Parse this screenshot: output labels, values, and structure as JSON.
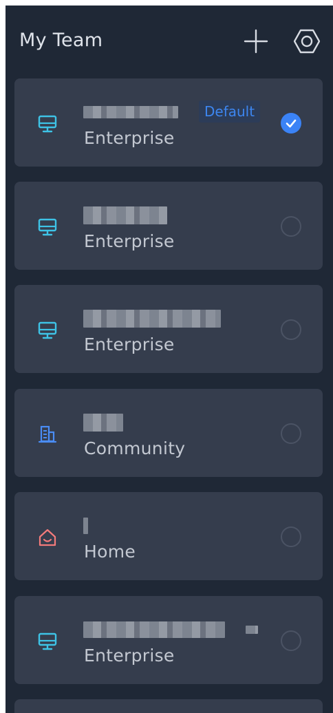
{
  "header": {
    "title": "My Team",
    "add_icon": "plus-icon",
    "settings_icon": "settings-hexagon-icon"
  },
  "teams": [
    {
      "type": "Enterprise",
      "icon": "desktop-icon",
      "icon_color": "#3ec3e6",
      "default_label": "Default",
      "selected": true
    },
    {
      "type": "Enterprise",
      "icon": "desktop-icon",
      "icon_color": "#3ec3e6",
      "selected": false
    },
    {
      "type": "Enterprise",
      "icon": "desktop-icon",
      "icon_color": "#3ec3e6",
      "selected": false
    },
    {
      "type": "Community",
      "icon": "building-icon",
      "icon_color": "#4a8df6",
      "selected": false
    },
    {
      "type": "Home",
      "icon": "home-icon",
      "icon_color": "#f47b7b",
      "selected": false
    },
    {
      "type": "Enterprise",
      "icon": "desktop-icon",
      "icon_color": "#3ec3e6",
      "selected": false
    }
  ],
  "colors": {
    "background": "#1f2836",
    "card": "#353d4d",
    "accent": "#3b83f6"
  }
}
